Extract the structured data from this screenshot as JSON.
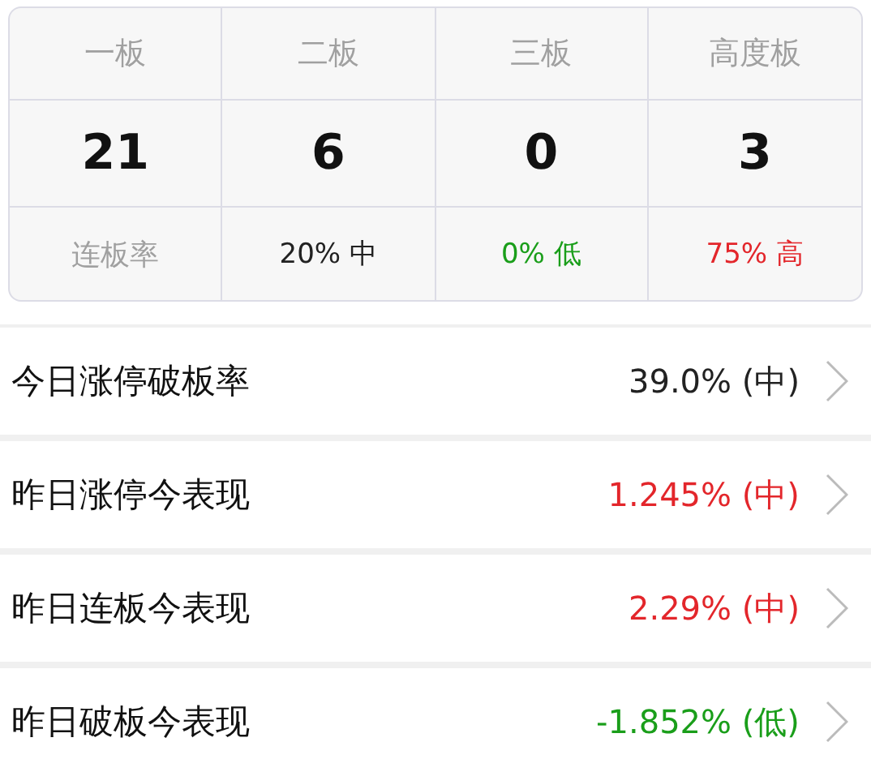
{
  "board_table": {
    "headers": [
      "一板",
      "二板",
      "三板",
      "高度板"
    ],
    "counts": [
      "21",
      "6",
      "0",
      "3"
    ],
    "rate_label": "连板率",
    "rates": [
      {
        "text": "20% 中",
        "color": "#222222"
      },
      {
        "text": "0% 低",
        "color": "#1a9e1a"
      },
      {
        "text": "75% 高",
        "color": "#e3262b"
      }
    ]
  },
  "stats": [
    {
      "label": "今日涨停破板率",
      "value": "39.0% (中)",
      "color": "#222222"
    },
    {
      "label": "昨日涨停今表现",
      "value": "1.245% (中)",
      "color": "#e3262b"
    },
    {
      "label": "昨日连板今表现",
      "value": "2.29% (中)",
      "color": "#e3262b"
    },
    {
      "label": "昨日破板今表现",
      "value": "-1.852% (低)",
      "color": "#1a9e1a"
    }
  ]
}
